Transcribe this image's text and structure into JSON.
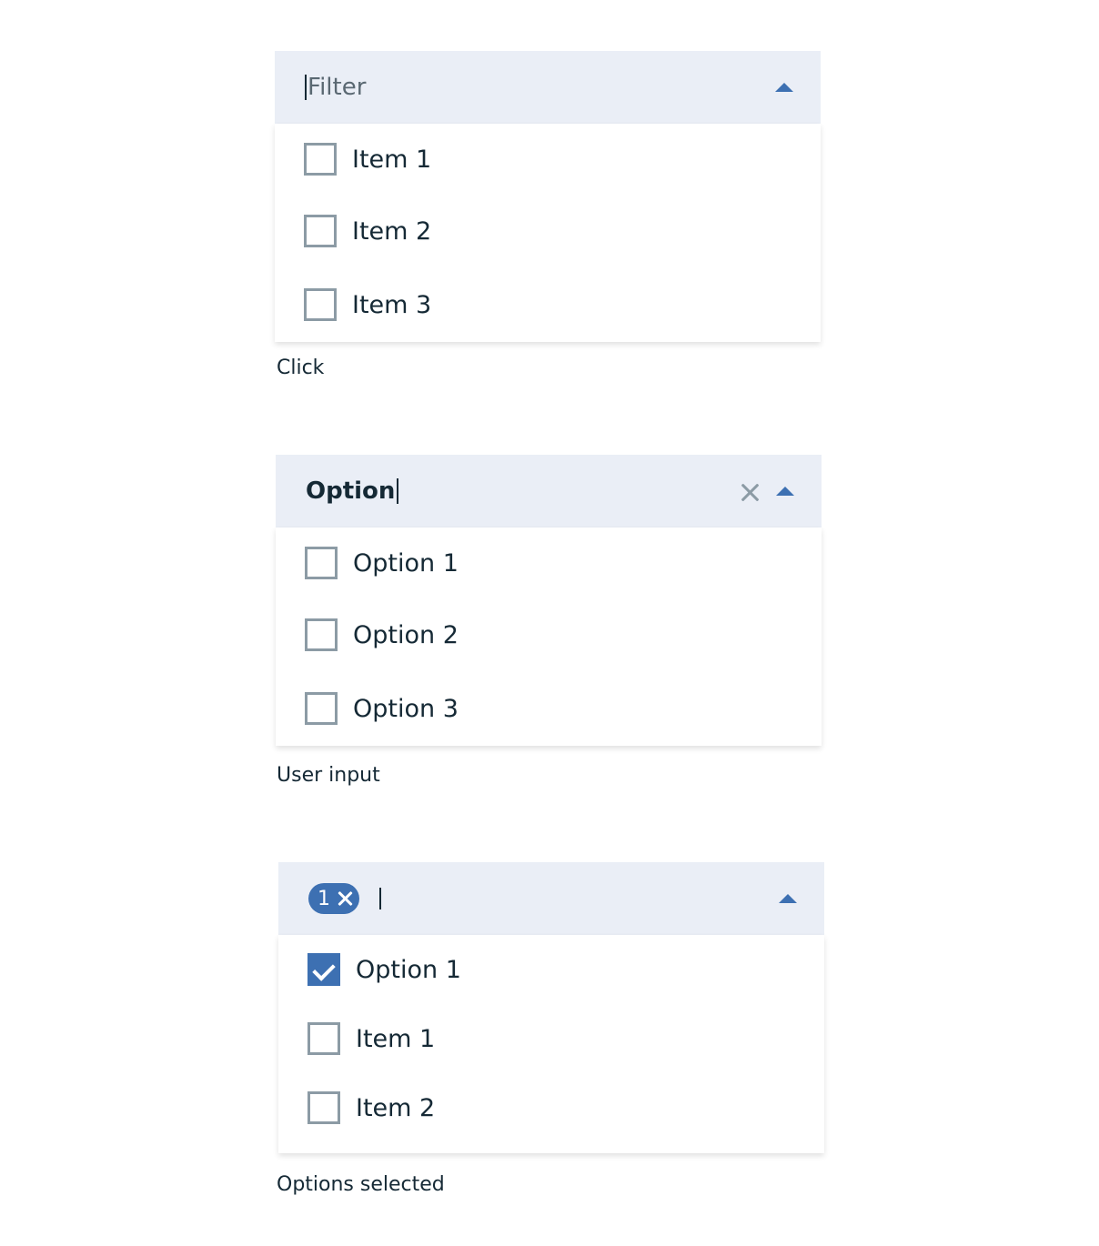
{
  "examples": [
    {
      "caption": "Click",
      "input_placeholder": "Filter",
      "items": [
        "Item 1",
        "Item 2",
        "Item 3"
      ]
    },
    {
      "caption": "User input",
      "input_value": "Option",
      "items": [
        "Option 1",
        "Option 2",
        "Option 3"
      ]
    },
    {
      "caption": "Options selected",
      "selected_count": "1",
      "items": [
        "Option 1",
        "Item 1",
        "Item 2"
      ],
      "checked": [
        true,
        false,
        false
      ]
    }
  ],
  "colors": {
    "field_bg": "#eaeef6",
    "accent": "#3d70b2",
    "text": "#152935",
    "checkbox_border": "#8c9ba5"
  },
  "icons": [
    "chevron-up-icon",
    "clear-icon",
    "tag-remove-icon",
    "checkmark-icon"
  ]
}
